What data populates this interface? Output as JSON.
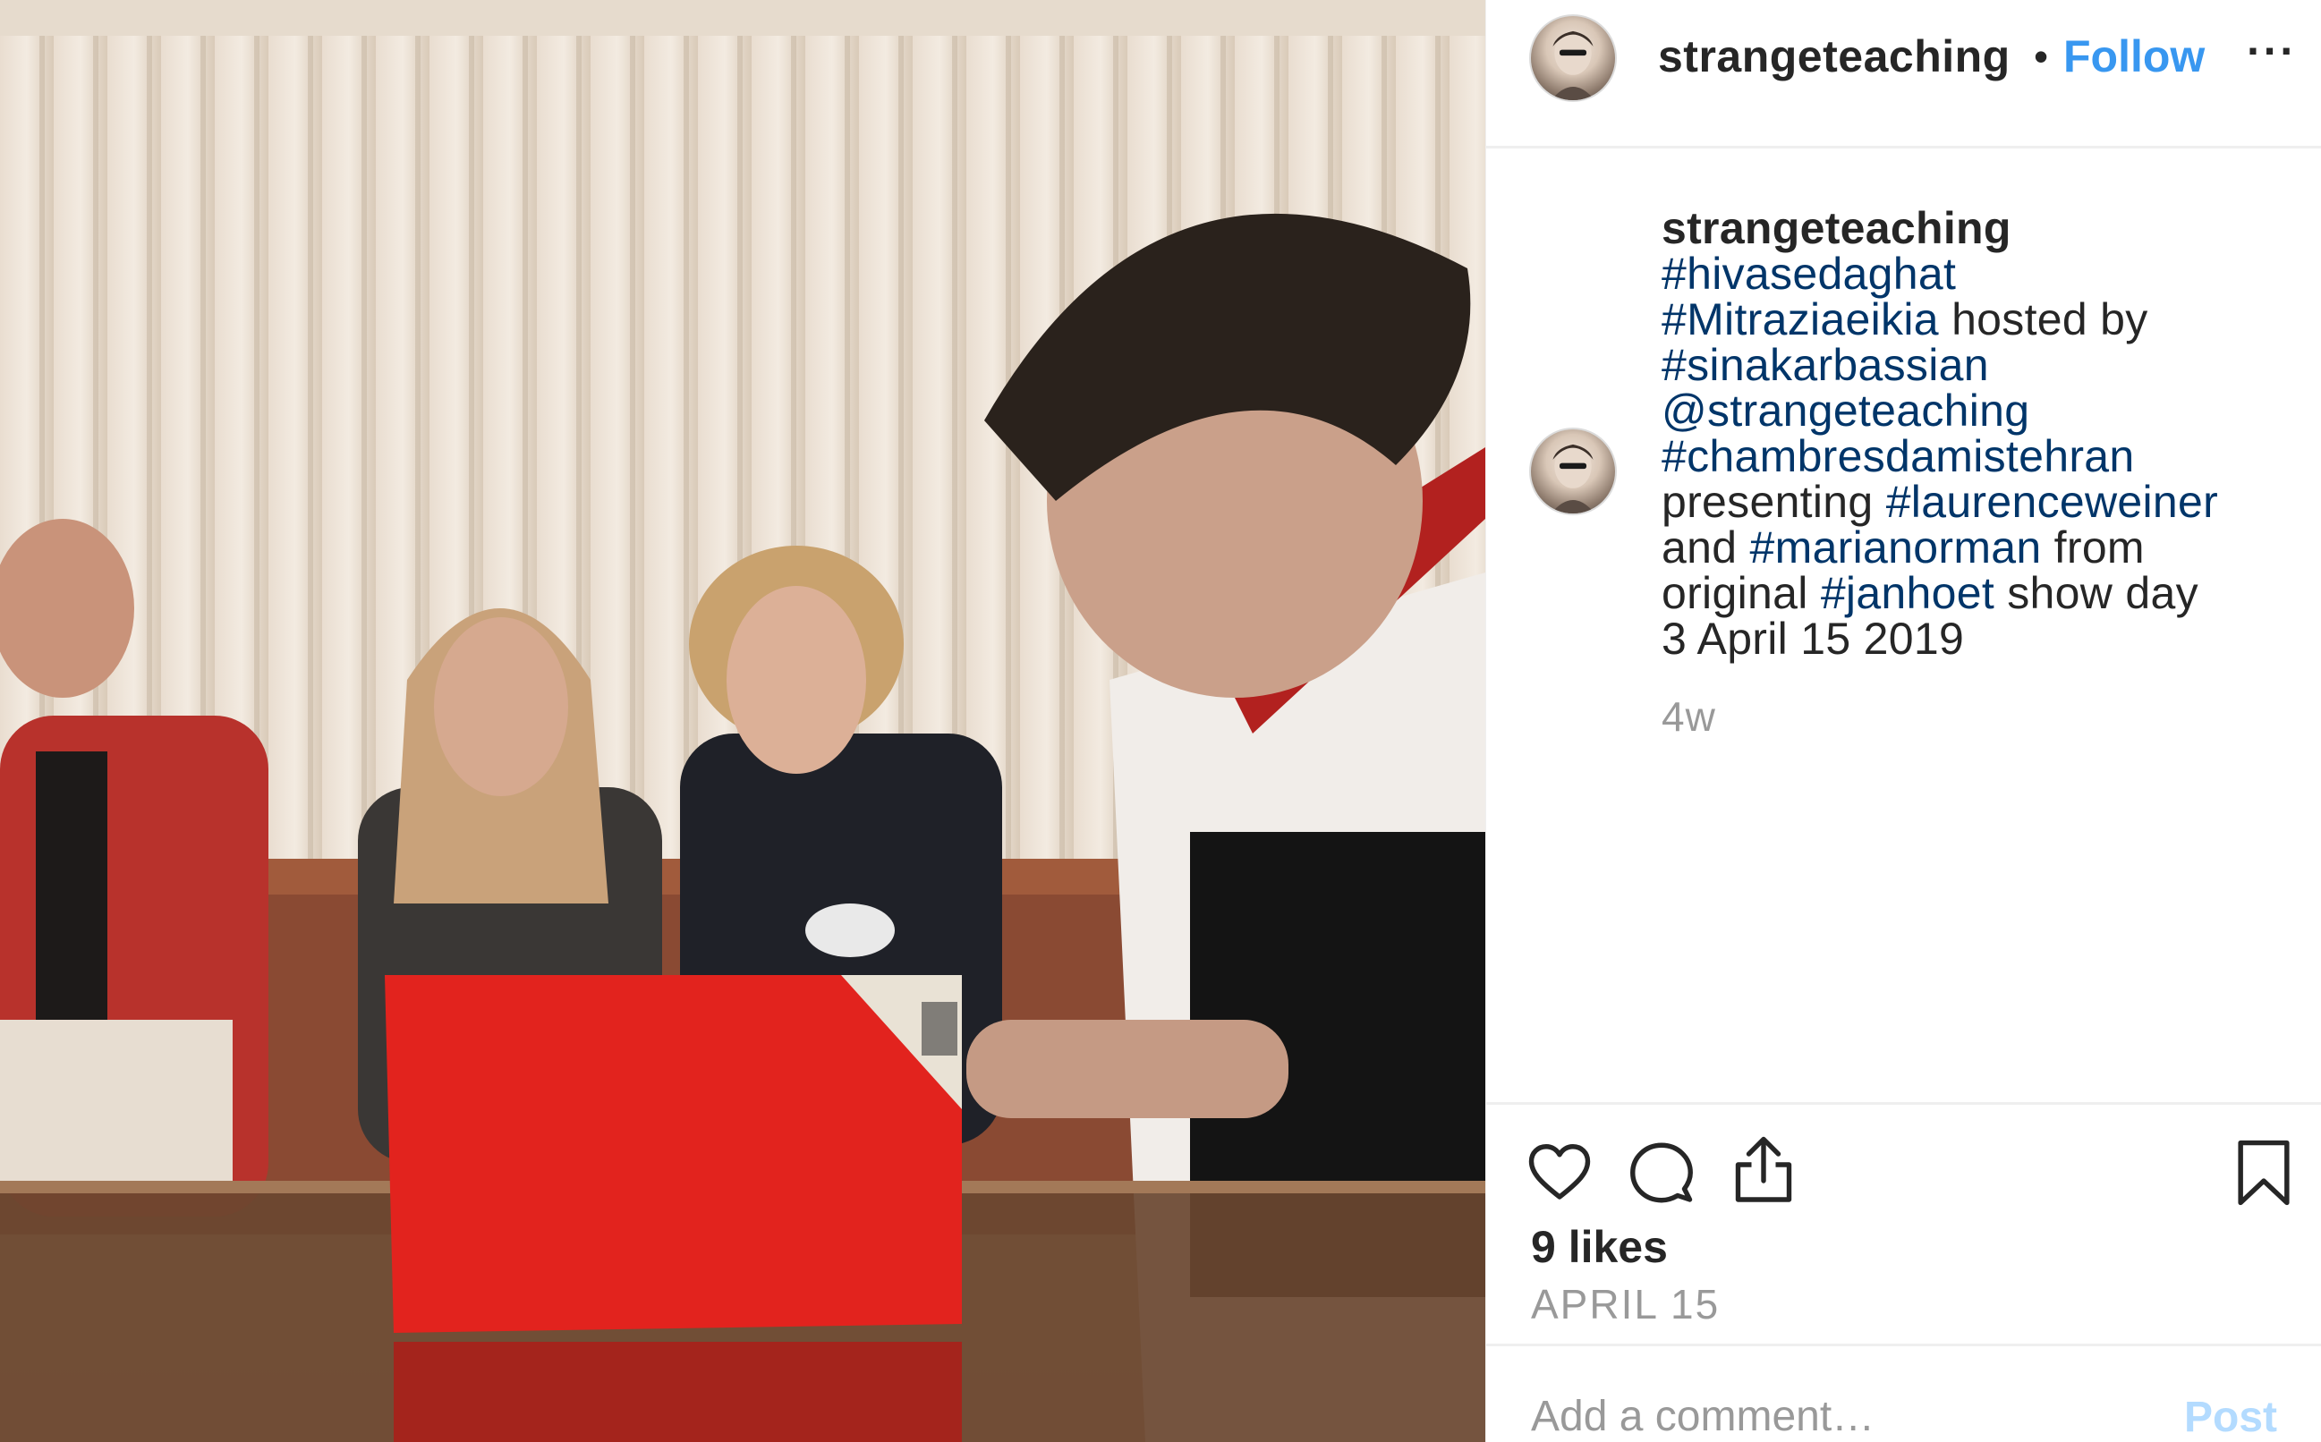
{
  "post": {
    "username": "strangeteaching",
    "separator": "•",
    "follow_label": "Follow",
    "more_label": "···"
  },
  "caption": {
    "username": "strangeteaching",
    "lines": [
      [
        {
          "t": "#hivasedaghat",
          "tag": true
        }
      ],
      [
        {
          "t": "#Mitraziaeikia",
          "tag": true
        },
        {
          "t": " hosted by",
          "tag": false
        }
      ],
      [
        {
          "t": "#sinakarbassian",
          "tag": true
        }
      ],
      [
        {
          "t": "@strangeteaching",
          "tag": true
        }
      ],
      [
        {
          "t": "#chambresdamistehran",
          "tag": true
        }
      ],
      [
        {
          "t": "presenting ",
          "tag": false
        },
        {
          "t": "#laurenceweiner",
          "tag": true
        }
      ],
      [
        {
          "t": "and ",
          "tag": false
        },
        {
          "t": "#marianorman",
          "tag": true
        },
        {
          "t": " from",
          "tag": false
        }
      ],
      [
        {
          "t": "original ",
          "tag": false
        },
        {
          "t": "#janhoet",
          "tag": true
        },
        {
          "t": " show day",
          "tag": false
        }
      ],
      [
        {
          "t": "3 April 15 2019",
          "tag": false
        }
      ]
    ],
    "age": "4w"
  },
  "actions": {
    "like_icon": "heart-icon",
    "comment_icon": "speech-bubble-icon",
    "share_icon": "share-icon",
    "save_icon": "bookmark-icon",
    "likes": "9 likes",
    "date": "APRIL 15"
  },
  "comment": {
    "placeholder": "Add a comment…",
    "post_label": "Post"
  },
  "colors": {
    "accent": "#3897f0",
    "hashtag": "#003569",
    "muted": "#999999",
    "post_disabled": "#b3dbff"
  }
}
